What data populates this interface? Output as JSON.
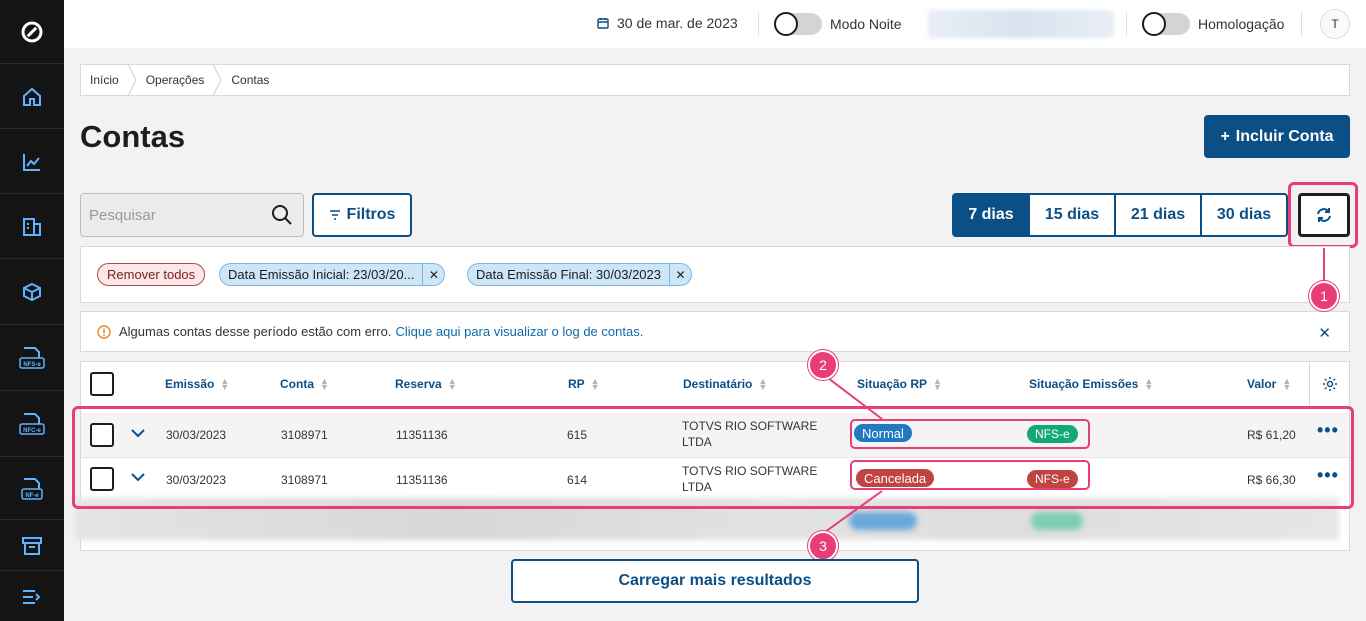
{
  "sidebar": {
    "items": [
      {
        "icon": "logo-icon"
      },
      {
        "icon": "home-icon"
      },
      {
        "icon": "chart-icon"
      },
      {
        "icon": "building-icon"
      },
      {
        "icon": "box-icon"
      },
      {
        "icon": "nfse-document-icon",
        "label": "NFS-e"
      },
      {
        "icon": "nfce-document-icon",
        "label": "NFC-e"
      },
      {
        "icon": "nfe-document-icon",
        "label": "NF-e"
      },
      {
        "icon": "archive-icon"
      },
      {
        "icon": "collapse-menu-icon"
      }
    ]
  },
  "header": {
    "date": "30 de mar. de 2023",
    "night_mode_label": "Modo Noite",
    "homolog_label": "Homologação",
    "avatar_initial": "T"
  },
  "breadcrumb": [
    "Início",
    "Operações",
    "Contas"
  ],
  "page": {
    "title": "Contas",
    "add_button": "Incluir Conta",
    "add_button_icon": "+"
  },
  "toolbar": {
    "search_placeholder": "Pesquisar",
    "filters_label": "Filtros",
    "periods": [
      "7 dias",
      "15 dias",
      "21 dias",
      "30 dias"
    ],
    "active_period": "7 dias"
  },
  "chips": {
    "remove_all": "Remover todos",
    "items": [
      "Data Emissão Inicial: 23/03/20...",
      "Data Emissão Final: 30/03/2023"
    ]
  },
  "alert": {
    "text": "Algumas contas desse período estão com erro.",
    "link": "Clique aqui para visualizar o log de contas."
  },
  "table": {
    "columns": [
      "Emissão",
      "Conta",
      "Reserva",
      "RP",
      "Destinatário",
      "Situação RP",
      "Situação Emissões",
      "Valor"
    ],
    "rows": [
      {
        "emissao": "30/03/2023",
        "conta": "3108971",
        "reserva": "11351136",
        "rp": "615",
        "destinatario_1": "TOTVS RIO SOFTWARE",
        "destinatario_2": "LTDA",
        "situacao_rp": "Normal",
        "situacao_emissoes": "NFS-e",
        "valor": "R$ 61,20"
      },
      {
        "emissao": "30/03/2023",
        "conta": "3108971",
        "reserva": "11351136",
        "rp": "614",
        "destinatario_1": "TOTVS RIO SOFTWARE",
        "destinatario_2": "LTDA",
        "situacao_rp": "Cancelada",
        "situacao_emissoes": "NFS-e",
        "valor": "R$ 66,30"
      }
    ],
    "more_icon": "•••"
  },
  "load_more": "Carregar mais resultados",
  "callouts": [
    "1",
    "2",
    "3"
  ],
  "colors": {
    "primary": "#0c4f86",
    "highlight": "#e83d77",
    "badge_normal": "#1f7ac1",
    "badge_cancelled": "#c0443f",
    "badge_nfse_ok": "#12a87a",
    "badge_nfse_cancelled": "#c0443f"
  }
}
